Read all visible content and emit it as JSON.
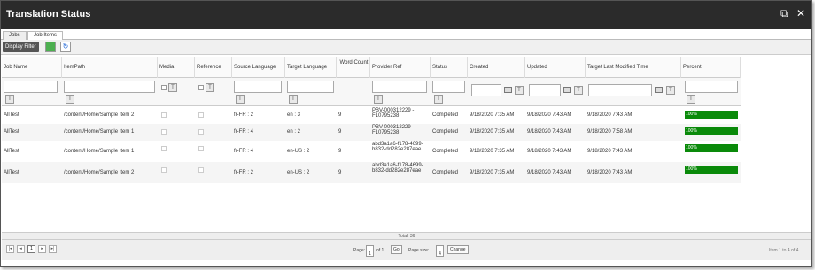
{
  "window": {
    "title": "Translation Status"
  },
  "tabs": [
    {
      "label": "Jobs"
    },
    {
      "label": "Job Items"
    }
  ],
  "toolbar": {
    "display_filter": "Display Filter"
  },
  "columns": [
    "Job Name",
    "ItemPath",
    "Media",
    "Reference",
    "Source Language",
    "Target Language",
    "Word Count",
    "Provider Ref",
    "Status",
    "Created",
    "Updated",
    "Target Last Modified Time",
    "Percent"
  ],
  "rows": [
    {
      "job": "AllTest",
      "path": "/content/Home/Sample Item 2",
      "src": "fr-FR : 2",
      "tgt": "en : 3",
      "words": "9",
      "ref": "PBV-000312229 - F10795238",
      "status": "Completed",
      "created": "9/18/2020 7:35 AM",
      "updated": "9/18/2020 7:43 AM",
      "tlm": "9/18/2020 7:43 AM",
      "percent": "100%",
      "percent_value": 100
    },
    {
      "job": "AllTest",
      "path": "/content/Home/Sample Item 1",
      "src": "fr-FR : 4",
      "tgt": "en : 2",
      "words": "9",
      "ref": "PBV-000312229 - F10795238",
      "status": "Completed",
      "created": "9/18/2020 7:35 AM",
      "updated": "9/18/2020 7:43 AM",
      "tlm": "9/18/2020 7:58 AM",
      "percent": "100%",
      "percent_value": 100
    },
    {
      "job": "AllTest",
      "path": "/content/Home/Sample Item 1",
      "src": "fr-FR : 4",
      "tgt": "en-US : 2",
      "words": "9",
      "ref": "abd3a1a6-f178-4699-b832-dd282e287eae",
      "status": "Completed",
      "created": "9/18/2020 7:35 AM",
      "updated": "9/18/2020 7:43 AM",
      "tlm": "9/18/2020 7:43 AM",
      "percent": "100%",
      "percent_value": 100
    },
    {
      "job": "AllTest",
      "path": "/content/Home/Sample Item 2",
      "src": "fr-FR : 2",
      "tgt": "en-US : 2",
      "words": "9",
      "ref": "abd3a1a6-f178-4699-b832-dd282e287eae",
      "status": "Completed",
      "created": "9/18/2020 7:35 AM",
      "updated": "9/18/2020 7:43 AM",
      "tlm": "9/18/2020 7:43 AM",
      "percent": "100%",
      "percent_value": 100
    }
  ],
  "footer": {
    "total": "Total: 36",
    "page_label": "Page:",
    "page_value": "1",
    "of_label": "of 1",
    "go": "Go",
    "page_size_label": "Page size:",
    "page_size_value": "4",
    "change": "Change",
    "current_page": "1",
    "item_range": "Item 1 to 4 of 4"
  },
  "colors": {
    "titlebar": "#2b2b2b",
    "progress": "#0a8a0a"
  }
}
